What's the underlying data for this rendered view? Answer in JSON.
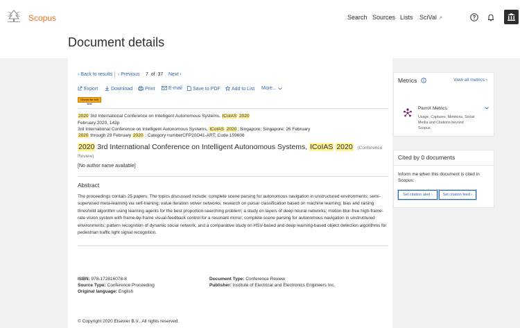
{
  "header": {
    "brand": "Scopus",
    "nav": {
      "search": "Search",
      "sources": "Sources",
      "lists": "Lists",
      "scival": "SciVal",
      "scival_ext": "↗"
    }
  },
  "page_title": "Document details",
  "pager": {
    "back": "Back to results",
    "prev": "Previous",
    "position": "7  of  37",
    "next": "Next"
  },
  "tools": {
    "export": "Export",
    "download": "Download",
    "print": "Print",
    "email": "E-mail",
    "pdf": "Save to PDF",
    "add_list": "Add to List",
    "more": "More..."
  },
  "check_full_text": "Check for full text",
  "source": {
    "l1_a": "2020",
    "l1_b": " 3rd International Conference on Intelligent Autonomous Systems, ",
    "l1_c": "ICoIAS",
    "l1_d": "2020",
    "l2": "February 2020, 143p",
    "l3_a": "3rd International Conference on Intelligent Autonomous Systems, ",
    "l3_b": "ICoIAS",
    "l3_c": "2020",
    "l3_d": "; Singapore; Singapore; 26 February",
    "l4_a": "2020",
    "l4_b": " through 29 February ",
    "l4_c": "2020",
    "l4_d": " ; Category numberCFP20O41-ART; Code 159606"
  },
  "doc_title": {
    "a": "2020",
    "b": " 3rd International Conference on Intelligent Autonomous Systems, ",
    "c": "ICoIAS",
    "d": "2020",
    "type_a": "(Conference",
    "type_b": "Review)"
  },
  "author": "[No author name available]",
  "abstract": {
    "heading": "Abstract",
    "text": "The proceedings contain 25 papers. The topics discussed include: complete scene parsing for autonomous navigation in unstructured environments; semi-supervised meta-learning via self-training; value iteration solver networks; research on pulsar classification based on machine learning; bias and raising threshold algorithm using learning agents for the best proportion-searching problem; a study on layers of deep neural networks; motion-blur-free high-frame-rate vision system with frame-by-frame visual-feedback control for a resonant mirror; complete scene parsing for autonomous navigation in unstructured environments; pattern recognition of dynamic social network; and a comparative study on HSV-based and deep learning-based object detection algorithms for pedestrian traffic light signal recognition."
  },
  "meta": {
    "isbn_label": "ISBN:",
    "isbn": " 978-172816078-8",
    "source_type_label": "Source Type:",
    "source_type": " Conference Proceeding",
    "lang_label": "Original language:",
    "lang": " English",
    "doc_type_label": "Document Type:",
    "doc_type": " Conference Review",
    "publisher_label": "Publisher:",
    "publisher": " Institute of Electrical and Electronics Engineers Inc."
  },
  "copyright": "© Copyright 2020 Elsevier B.V., All rights reserved.",
  "metrics": {
    "heading": "Metrics",
    "view_all": "View all metrics",
    "plumx_title": "PlumX Metrics",
    "plumx_desc": "Usage, Captures, Mentions, Social Media and Citations beyond Scopus."
  },
  "cited": {
    "heading": "Cited by 0 documents",
    "inform": "Inform me when this document is cited in Scopus:",
    "alert": "Set citation alert",
    "feed": "Set citation feed"
  }
}
